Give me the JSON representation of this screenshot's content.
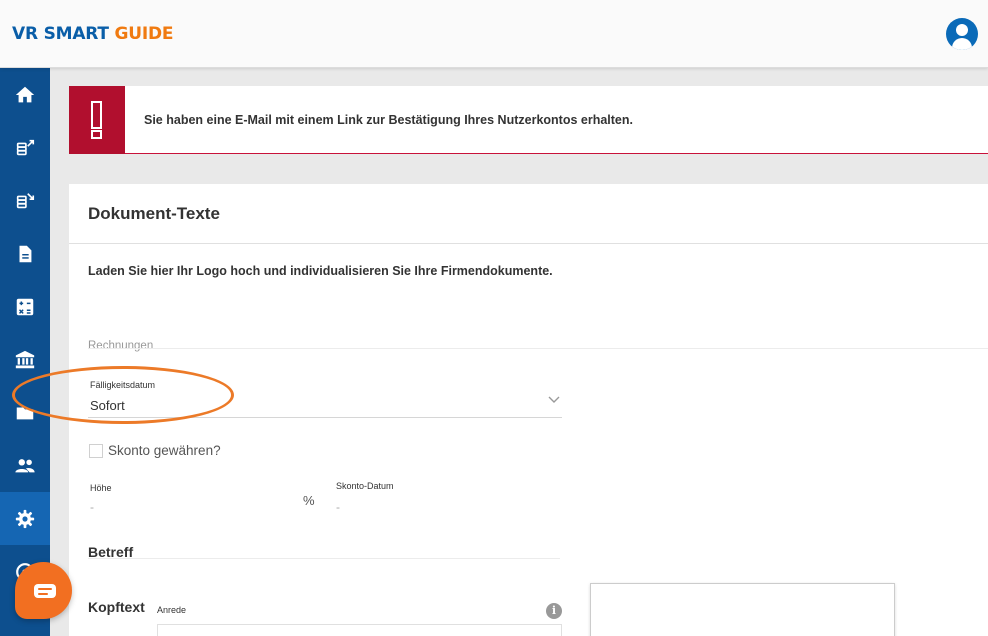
{
  "header": {
    "logo_part1": "VR SMART ",
    "logo_part2": "GUIDE"
  },
  "sidebar": {
    "items": [
      {
        "icon": "home-icon"
      },
      {
        "icon": "money-out-icon"
      },
      {
        "icon": "money-in-icon"
      },
      {
        "icon": "document-icon"
      },
      {
        "icon": "calculator-icon"
      },
      {
        "icon": "bank-icon"
      },
      {
        "icon": "folder-icon"
      },
      {
        "icon": "users-icon"
      },
      {
        "icon": "settings-icon",
        "active": true
      },
      {
        "icon": "help-icon"
      }
    ]
  },
  "alert": {
    "icon": "exclamation-icon",
    "message": "Sie haben eine E-Mail mit einem Link zur Bestätigung Ihres Nutzerkontos erhalten."
  },
  "card": {
    "title": "Dokument-Texte",
    "intro": "Laden Sie hier Ihr Logo hoch und individualisieren Sie Ihre Firmendokumente.",
    "section_label": "Rechnungen",
    "due_date": {
      "label": "Fälligkeitsdatum",
      "value": "Sofort"
    },
    "discount": {
      "checkbox_label": "Skonto gewähren?",
      "amount_label": "Höhe",
      "amount_value": "-",
      "percent_symbol": "%",
      "date_label": "Skonto-Datum",
      "date_value": "-"
    },
    "subject_heading": "Betreff",
    "header_text_heading": "Kopftext",
    "salutation_label": "Anrede",
    "info_symbol": "i"
  },
  "colors": {
    "primary_blue": "#0d4f8e",
    "active_blue": "#1566b3",
    "brand_orange": "#f07a10",
    "alert_red": "#b10f2e",
    "annotation_orange": "#ec7a28"
  }
}
